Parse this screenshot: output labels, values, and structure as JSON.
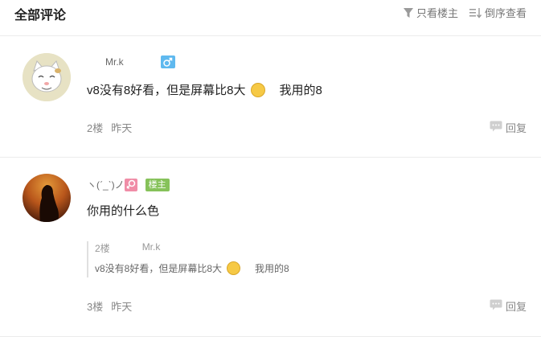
{
  "header": {
    "title": "全部评论",
    "only_op_label": "只看楼主",
    "reverse_label": "倒序查看"
  },
  "comments": [
    {
      "author": "Mr.k",
      "gender": "male",
      "text_before": "v8没有8好看，但是屏幕比8大",
      "text_after": "我用的8",
      "floor": "2楼",
      "time": "昨天",
      "reply_label": "回复"
    },
    {
      "author": "ヽ(ˊ_ˋ)ノ",
      "gender": "female",
      "op_badge": "楼主",
      "text": "你用的什么色",
      "quote": {
        "floor": "2楼",
        "author": "Mr.k",
        "text_before": "v8没有8好看，但是屏幕比8大",
        "text_after": "我用的8"
      },
      "floor": "3楼",
      "time": "昨天",
      "reply_label": "回复"
    }
  ],
  "icons": {
    "filter": "filter-icon",
    "sort": "sort-icon",
    "reply": "comment-bubble-icon",
    "male": "male-gender-icon",
    "female": "female-gender-icon",
    "emoji": "laughing-tears-emoji-icon"
  },
  "colors": {
    "male_badge": "#5fb9ef",
    "female_badge": "#f08da7",
    "op_badge": "#86c25a"
  }
}
